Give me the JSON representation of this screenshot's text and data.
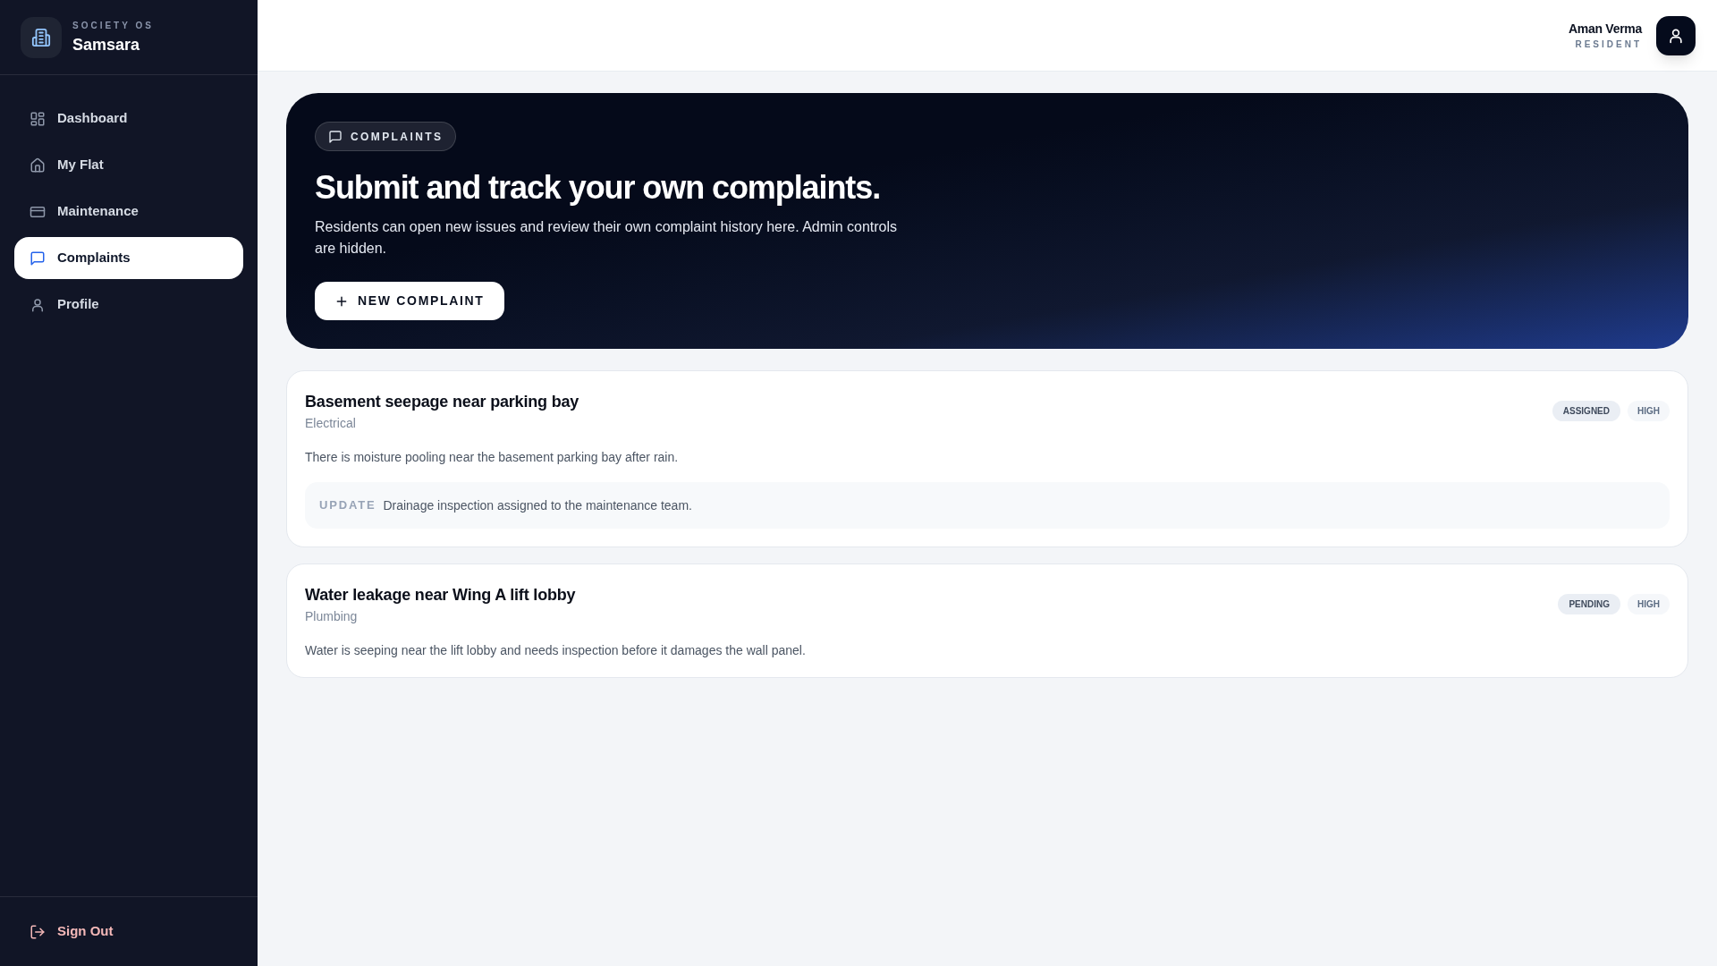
{
  "sidebar": {
    "brand": {
      "eyebrow": "SOCIETY OS",
      "name": "Samsara"
    },
    "items": [
      {
        "label": "Dashboard",
        "selected": false
      },
      {
        "label": "My Flat",
        "selected": false
      },
      {
        "label": "Maintenance",
        "selected": false
      },
      {
        "label": "Complaints",
        "selected": true
      },
      {
        "label": "Profile",
        "selected": false
      }
    ],
    "sign_out": "Sign Out"
  },
  "header": {
    "user": {
      "name": "Aman Verma",
      "role": "RESIDENT"
    }
  },
  "hero": {
    "badge": "COMPLAINTS",
    "title": "Submit and track your own complaints.",
    "description": "Residents can open new issues and review their own complaint history here. Admin controls are hidden.",
    "button": "NEW COMPLAINT"
  },
  "complaints": [
    {
      "title": "Basement seepage near parking bay",
      "category": "Electrical",
      "description": "There is moisture pooling near the basement parking bay after rain.",
      "status": "ASSIGNED",
      "priority": "HIGH",
      "update": {
        "label": "UPDATE",
        "text": "Drainage inspection assigned to the maintenance team."
      }
    },
    {
      "title": "Water leakage near Wing A lift lobby",
      "category": "Plumbing",
      "description": "Water is seeping near the lift lobby and needs inspection before it damages the wall panel.",
      "status": "PENDING",
      "priority": "HIGH"
    }
  ]
}
